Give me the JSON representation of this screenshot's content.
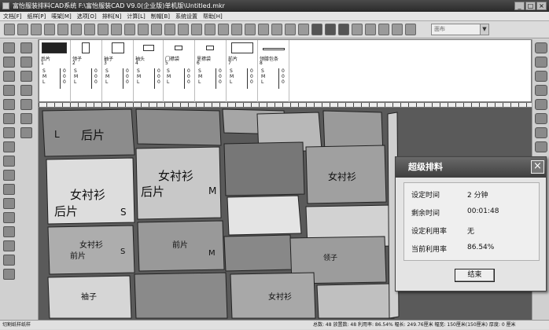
{
  "window": {
    "title": "富怡服装排料CAD系统 F:\\富怡服装CAD V9.0(企业版)单机版\\Untitled.mkr",
    "min": "_",
    "max": "□",
    "close": "×"
  },
  "menu": [
    "文档[F]",
    "纸样[P]",
    "唛架[M]",
    "选项[O]",
    "排料[N]",
    "计算[L]",
    "制帽[B]",
    "系统设置",
    "帮助[H]"
  ],
  "toolbar": {
    "combo_placeholder": "面布",
    "combo_arrow": "▼"
  },
  "pieces": [
    {
      "name": "后片",
      "no": "1",
      "sizes": "S\nM\nL",
      "counts": "0\n0\n0"
    },
    {
      "name": "领子",
      "no": "2",
      "sizes": "S\nM\nL",
      "counts": "0\n0\n0"
    },
    {
      "name": "袖子",
      "no": "3",
      "sizes": "S\nM\nL",
      "counts": "0\n0\n0"
    },
    {
      "name": "袖头",
      "no": "4",
      "sizes": "S\nM\nL",
      "counts": "0\n0\n0"
    },
    {
      "name": "门襟袋",
      "no": "5",
      "sizes": "S\nM\nL",
      "counts": "0\n0\n0"
    },
    {
      "name": "里襟袋",
      "no": "6",
      "sizes": "S\nM\nL",
      "counts": "0\n0\n0"
    },
    {
      "name": "前片",
      "no": "7",
      "sizes": "S\nM\nL",
      "counts": "0\n0\n0"
    },
    {
      "name": "领膝包条",
      "no": "8",
      "sizes": "S\nM\nL",
      "counts": "0\n0\n0"
    }
  ],
  "marker_labels": [
    "后片",
    "女衬衫",
    "后片",
    "女衬衫",
    "M",
    "女衬衫",
    "后片",
    "S",
    "女衬衫",
    "前片",
    "袖子",
    "领子",
    "前片",
    "女衬衫",
    "S",
    "M",
    "L"
  ],
  "dialog": {
    "title": "超级排料",
    "rows": [
      {
        "label": "设定时间",
        "value": "2 分钟"
      },
      {
        "label": "剩余时间",
        "value": "00:01:48"
      },
      {
        "label": "设定利用率",
        "value": "无"
      },
      {
        "label": "当前利用率",
        "value": "86.54%"
      }
    ],
    "button": "结束",
    "close": "×"
  },
  "status": {
    "left": "切割纸样纸样",
    "right": "总数: 48  放置数: 48  利用率: 86.54%  幅长: 249.76厘米  幅宽: 150厘米(150厘米)  厚度: 0  厘米"
  }
}
